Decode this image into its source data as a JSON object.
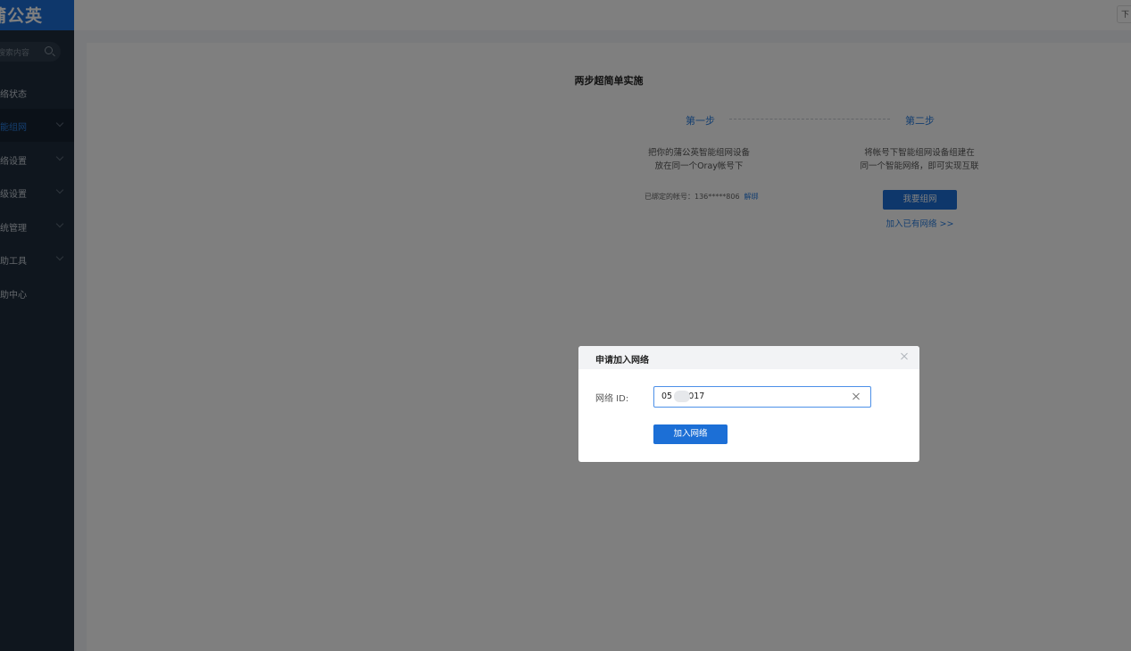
{
  "brand": {
    "logo_text": "蒲公英"
  },
  "sidebar": {
    "search_placeholder": "搜索内容",
    "items": [
      {
        "label": "网络状态",
        "active": false,
        "has_chevron": false
      },
      {
        "label": "智能组网",
        "active": true,
        "has_chevron": true
      },
      {
        "label": "网络设置",
        "active": false,
        "has_chevron": true
      },
      {
        "label": "高级设置",
        "active": false,
        "has_chevron": true
      },
      {
        "label": "系统管理",
        "active": false,
        "has_chevron": true
      },
      {
        "label": "辅助工具",
        "active": false,
        "has_chevron": true
      },
      {
        "label": "帮助中心",
        "active": false,
        "has_chevron": false
      }
    ]
  },
  "header": {
    "right_button": "下"
  },
  "main": {
    "title": "两步超简单实施",
    "step1": {
      "label": "第一步",
      "desc_line1": "把你的蒲公英智能组网设备",
      "desc_line2": "放在同一个Oray帐号下",
      "bound_account": "已绑定的帐号：136*****806",
      "unbind": "解绑"
    },
    "step2": {
      "label": "第二步",
      "desc_line1": "将帐号下智能组网设备组建在",
      "desc_line2": "同一个智能网络，即可实现互联",
      "create_button": "我要组网",
      "join_link": "加入已有网络 >>"
    }
  },
  "modal": {
    "title": "申请加入网络",
    "field_label": "网络 ID:",
    "field_value": "05      017",
    "submit_button": "加入网络"
  },
  "colors": {
    "accent": "#1c6fd6",
    "sidebar_bg": "#1f2d3d",
    "overlay": "rgba(0,0,0,0.5)"
  }
}
